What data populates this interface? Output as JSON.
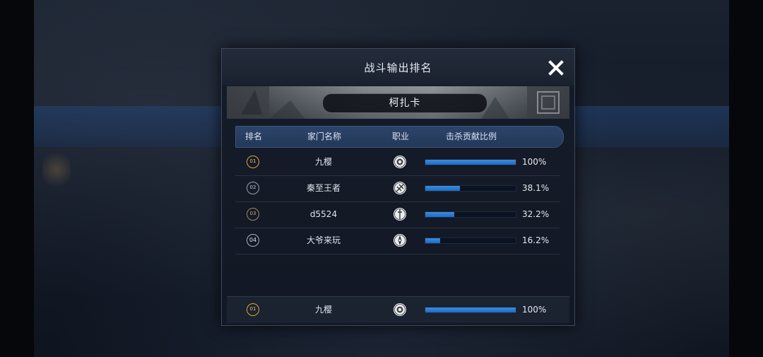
{
  "dialog": {
    "title": "战斗输出排名",
    "boss_name": "柯扎卡"
  },
  "table": {
    "headers": [
      "排名",
      "家门名称",
      "职业",
      "击杀贡献比例"
    ],
    "rows": [
      {
        "rank": "01",
        "rank_style": "gold",
        "name": "九樱",
        "job_icon": "lion-crest-icon",
        "ratio": 1.0,
        "pct": "100%"
      },
      {
        "rank": "02",
        "rank_style": "silver",
        "name": "秦至王者",
        "job_icon": "crossed-blades-icon",
        "ratio": 0.381,
        "pct": "38.1%"
      },
      {
        "rank": "03",
        "rank_style": "bronze",
        "name": "d5524",
        "job_icon": "sword-emblem-icon",
        "ratio": 0.322,
        "pct": "32.2%"
      },
      {
        "rank": "04",
        "rank_style": "plain",
        "name": "大爷来玩",
        "job_icon": "compass-emblem-icon",
        "ratio": 0.162,
        "pct": "16.2%"
      }
    ]
  },
  "self_row": {
    "rank": "01",
    "rank_style": "gold",
    "name": "九樱",
    "job_icon": "lion-crest-icon",
    "ratio": 1.0,
    "pct": "100%"
  },
  "colors": {
    "accent_bar": "#2a7bd6",
    "gold": "#d8a93a",
    "header_blue": "#2d4469"
  }
}
